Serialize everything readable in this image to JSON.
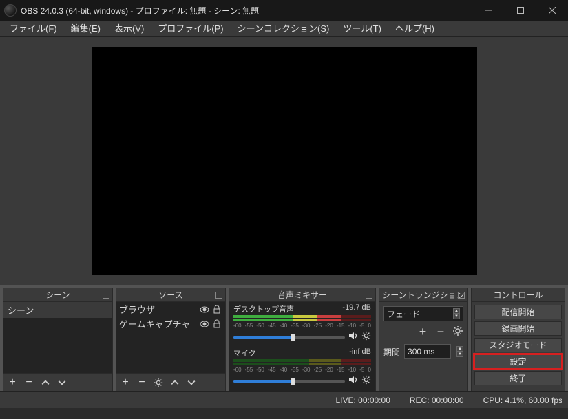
{
  "window": {
    "title": "OBS 24.0.3 (64-bit, windows) - プロファイル: 無題 - シーン: 無題"
  },
  "menu": {
    "file": "ファイル(F)",
    "edit": "編集(E)",
    "view": "表示(V)",
    "profile": "プロファイル(P)",
    "scene_collection": "シーンコレクション(S)",
    "tools": "ツール(T)",
    "help": "ヘルプ(H)"
  },
  "docks": {
    "scenes": {
      "title": "シーン",
      "items": [
        "シーン"
      ]
    },
    "sources": {
      "title": "ソース",
      "items": [
        "ブラウザ",
        "ゲームキャプチャ"
      ]
    },
    "mixer": {
      "title": "音声ミキサー",
      "ticks": [
        "-60",
        "-55",
        "-50",
        "-45",
        "-40",
        "-35",
        "-30",
        "-25",
        "-20",
        "-15",
        "-10",
        "-5",
        "0"
      ],
      "channels": [
        {
          "name": "デスクトップ音声",
          "db": "-19.7 dB",
          "slider_pct": 52
        },
        {
          "name": "マイク",
          "db": "-inf dB",
          "slider_pct": 52
        }
      ]
    },
    "transitions": {
      "title": "シーントランジション",
      "selected": "フェード",
      "duration_label": "期間",
      "duration_value": "300 ms"
    },
    "controls": {
      "title": "コントロール",
      "buttons": {
        "start_stream": "配信開始",
        "start_record": "録画開始",
        "studio_mode": "スタジオモード",
        "settings": "設定",
        "exit": "終了"
      }
    }
  },
  "status": {
    "live": "LIVE: 00:00:00",
    "rec": "REC: 00:00:00",
    "cpu": "CPU: 4.1%, 60.00 fps"
  }
}
